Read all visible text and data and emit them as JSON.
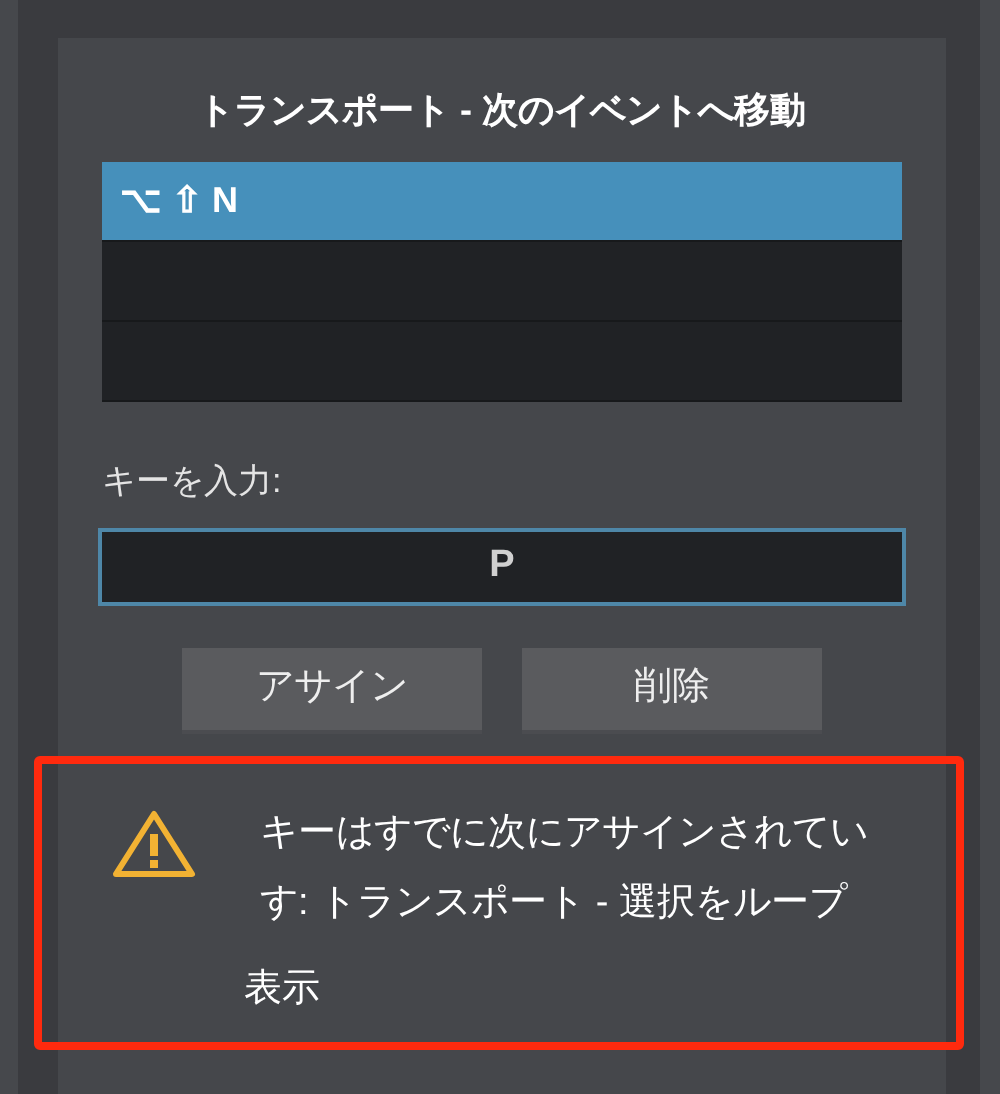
{
  "dialog": {
    "title": "トランスポート - 次のイベントへ移動"
  },
  "shortcuts": [
    {
      "label": "⌥ ⇧ N",
      "selected": true
    },
    {
      "selected": false
    },
    {
      "selected": false
    }
  ],
  "key_input": {
    "label": "キーを入力:",
    "value": "P"
  },
  "buttons": [
    "アサイン",
    "削除"
  ],
  "warning": {
    "message_lines": [
      "キーはすでに次にアサインされてい",
      "す: トランスポート - 選択をループ"
    ],
    "link": "表示"
  }
}
